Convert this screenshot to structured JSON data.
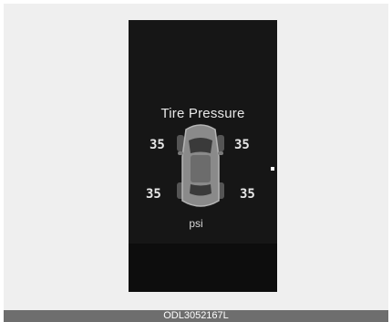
{
  "screen": {
    "title": "Tire Pressure",
    "unit": "psi"
  },
  "tires": {
    "front_left": "35",
    "front_right": "35",
    "rear_left": "35",
    "rear_right": "35"
  },
  "caption": "ODL3052167L",
  "colors": {
    "cluster_background": "#161616",
    "page_background": "#efefef",
    "caption_bar": "#6e6e6e"
  },
  "icons": {
    "car": "car-top-view-icon"
  }
}
